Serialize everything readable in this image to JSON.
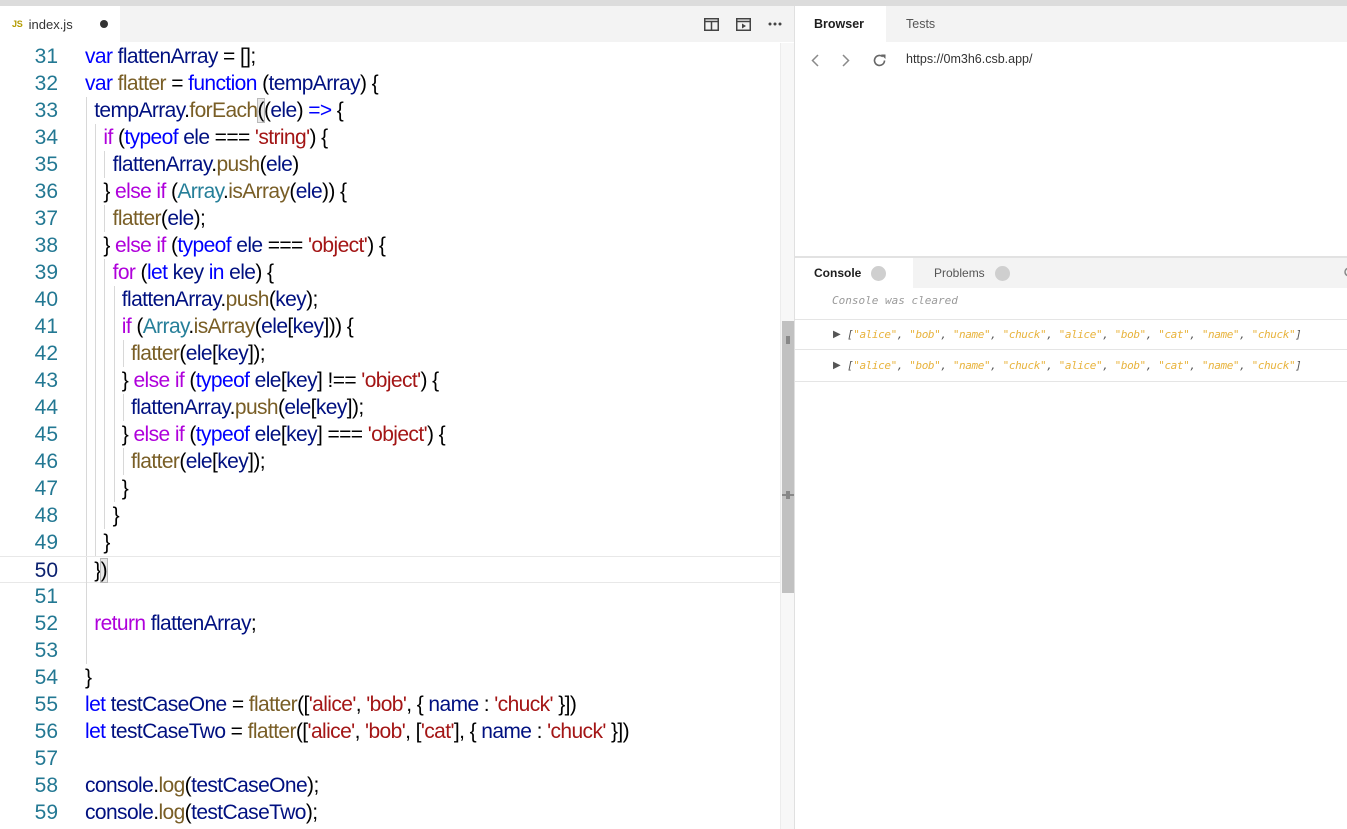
{
  "editor": {
    "tab": {
      "badge": "JS",
      "filename": "index.js"
    },
    "actions": [
      "split-editor-icon",
      "open-preview-icon",
      "more-actions-icon"
    ],
    "current_line": 50
  },
  "code_lines": [
    {
      "n": "31",
      "indent": 0,
      "html": "<span class='kw'>var</span> <span class='var'>flattenArray</span> = [];"
    },
    {
      "n": "32",
      "indent": 0,
      "html": "<span class='kw'>var</span> <span class='fn'>flatter</span> = <span class='kw'>function</span> (<span class='var'>tempArray</span>) {"
    },
    {
      "n": "33",
      "indent": 1,
      "html": "<span class='var'>tempArray</span>.<span class='fn'>forEach</span><span class='bm'>(</span>(<span class='var'>ele</span>) <span class='kw'>=&gt;</span> {"
    },
    {
      "n": "34",
      "indent": 2,
      "html": "<span class='ctl'>if</span> (<span class='kw'>typeof</span> <span class='var'>ele</span> === <span class='str'>'string'</span>) {"
    },
    {
      "n": "35",
      "indent": 3,
      "html": "<span class='var'>flattenArray</span>.<span class='fn'>push</span>(<span class='var'>ele</span>)"
    },
    {
      "n": "36",
      "indent": 2,
      "html": "} <span class='ctl'>else</span> <span class='ctl'>if</span> (<span class='cls'>Array</span>.<span class='fn'>isArray</span>(<span class='var'>ele</span>)) {"
    },
    {
      "n": "37",
      "indent": 3,
      "html": "<span class='fn'>flatter</span>(<span class='var'>ele</span>);"
    },
    {
      "n": "38",
      "indent": 2,
      "html": "} <span class='ctl'>else</span> <span class='ctl'>if</span> (<span class='kw'>typeof</span> <span class='var'>ele</span> === <span class='str'>'object'</span>) {"
    },
    {
      "n": "39",
      "indent": 3,
      "html": "<span class='ctl'>for</span> (<span class='kw'>let</span> <span class='var'>key</span> <span class='kw'>in</span> <span class='var'>ele</span>) {"
    },
    {
      "n": "40",
      "indent": 4,
      "html": "<span class='var'>flattenArray</span>.<span class='fn'>push</span>(<span class='var'>key</span>);"
    },
    {
      "n": "41",
      "indent": 4,
      "html": "<span class='ctl'>if</span> (<span class='cls'>Array</span>.<span class='fn'>isArray</span>(<span class='var'>ele</span>[<span class='var'>key</span>])) {"
    },
    {
      "n": "42",
      "indent": 5,
      "html": "<span class='fn'>flatter</span>(<span class='var'>ele</span>[<span class='var'>key</span>]);"
    },
    {
      "n": "43",
      "indent": 4,
      "html": "} <span class='ctl'>else</span> <span class='ctl'>if</span> (<span class='kw'>typeof</span> <span class='var'>ele</span>[<span class='var'>key</span>] !== <span class='str'>'object'</span>) {"
    },
    {
      "n": "44",
      "indent": 5,
      "html": "<span class='var'>flattenArray</span>.<span class='fn'>push</span>(<span class='var'>ele</span>[<span class='var'>key</span>]);"
    },
    {
      "n": "45",
      "indent": 4,
      "html": "} <span class='ctl'>else</span> <span class='ctl'>if</span> (<span class='kw'>typeof</span> <span class='var'>ele</span>[<span class='var'>key</span>] === <span class='str'>'object'</span>) {"
    },
    {
      "n": "46",
      "indent": 5,
      "html": "<span class='fn'>flatter</span>(<span class='var'>ele</span>[<span class='var'>key</span>]);"
    },
    {
      "n": "47",
      "indent": 4,
      "html": "}"
    },
    {
      "n": "48",
      "indent": 3,
      "html": "}"
    },
    {
      "n": "49",
      "indent": 2,
      "html": "}"
    },
    {
      "n": "50",
      "indent": 1,
      "html": "}<span class='bm'>)</span>"
    },
    {
      "n": "51",
      "indent": 1,
      "html": ""
    },
    {
      "n": "52",
      "indent": 1,
      "html": "<span class='ctl'>return</span> <span class='var'>flattenArray</span>;"
    },
    {
      "n": "53",
      "indent": 1,
      "html": ""
    },
    {
      "n": "54",
      "indent": 0,
      "html": "}"
    },
    {
      "n": "55",
      "indent": 0,
      "html": "<span class='kw'>let</span> <span class='var'>testCaseOne</span> = <span class='fn'>flatter</span>([<span class='str'>'alice'</span>, <span class='str'>'bob'</span>, { <span class='var'>name</span> : <span class='str'>'chuck'</span> }])"
    },
    {
      "n": "56",
      "indent": 0,
      "html": "<span class='kw'>let</span> <span class='var'>testCaseTwo</span> = <span class='fn'>flatter</span>([<span class='str'>'alice'</span>, <span class='str'>'bob'</span>, [<span class='str'>'cat'</span>], { <span class='var'>name</span> : <span class='str'>'chuck'</span> }])"
    },
    {
      "n": "57",
      "indent": 0,
      "html": ""
    },
    {
      "n": "58",
      "indent": 0,
      "html": "<span class='var'>console</span>.<span class='fn'>log</span>(<span class='var'>testCaseOne</span>);"
    },
    {
      "n": "59",
      "indent": 0,
      "html": "<span class='var'>console</span>.<span class='fn'>log</span>(<span class='var'>testCaseTwo</span>);"
    }
  ],
  "preview": {
    "tabs": [
      {
        "label": "Browser",
        "active": true
      },
      {
        "label": "Tests",
        "active": false
      }
    ],
    "url": "https://0m3h6.csb.app/"
  },
  "console": {
    "tabs": [
      {
        "label": "Console",
        "active": true
      },
      {
        "label": "Problems",
        "active": false
      }
    ],
    "cleared_text": "Console was cleared",
    "logs": [
      {
        "items": [
          "\"alice\"",
          "\"bob\"",
          "\"name\"",
          "\"chuck\"",
          "\"alice\"",
          "\"bob\"",
          "\"cat\"",
          "\"name\"",
          "\"chuck\""
        ]
      },
      {
        "items": [
          "\"alice\"",
          "\"bob\"",
          "\"name\"",
          "\"chuck\"",
          "\"alice\"",
          "\"bob\"",
          "\"cat\"",
          "\"name\"",
          "\"chuck\""
        ]
      }
    ]
  }
}
